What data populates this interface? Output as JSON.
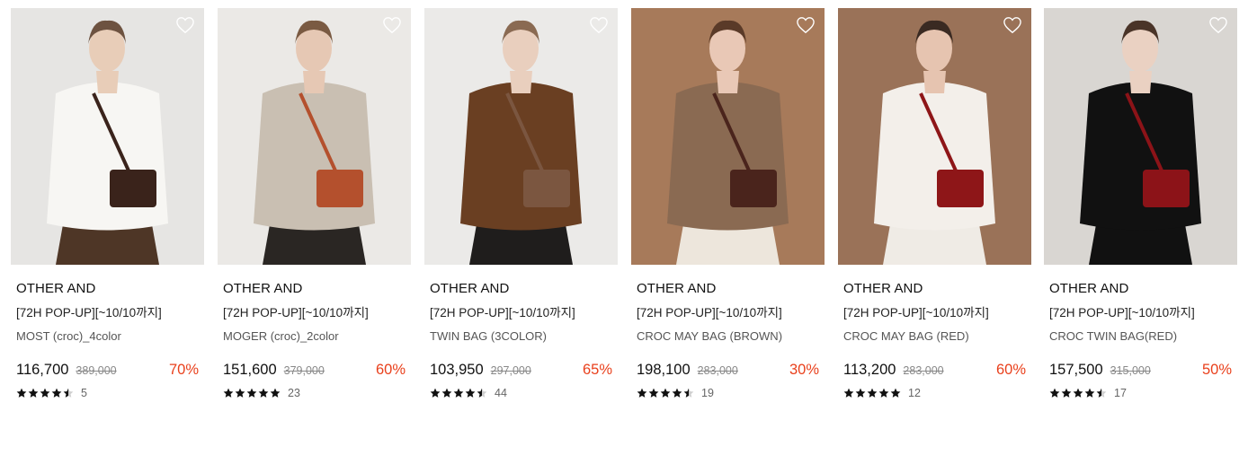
{
  "products": [
    {
      "brand": "OTHER AND",
      "promo": "[72H POP-UP][~10/10까지]",
      "name": "MOST (croc)_4color",
      "price": "116,700",
      "original_price": "389,000",
      "discount": "70%",
      "rating": 4.5,
      "review_count": "5",
      "colors": {
        "bg": "#e6e5e3",
        "coat": "#f7f6f3",
        "skirt": "#4e3626",
        "bag": "#3a231b",
        "skin": "#e8cdb8",
        "hair": "#6d5240"
      }
    },
    {
      "brand": "OTHER AND",
      "promo": "[72H POP-UP][~10/10까지]",
      "name": "MOGER (croc)_2color",
      "price": "151,600",
      "original_price": "379,000",
      "discount": "60%",
      "rating": 5,
      "review_count": "23",
      "colors": {
        "bg": "#ebe9e6",
        "coat": "#c9bfb2",
        "skirt": "#2a2623",
        "bag": "#b4502d",
        "skin": "#e6c8b4",
        "hair": "#7a5a42"
      }
    },
    {
      "brand": "OTHER AND",
      "promo": "[72H POP-UP][~10/10까지]",
      "name": "TWIN BAG (3COLOR)",
      "price": "103,950",
      "original_price": "297,000",
      "discount": "65%",
      "rating": 4.5,
      "review_count": "44",
      "colors": {
        "bg": "#ebeae8",
        "coat": "#6a3f22",
        "skirt": "#1f1d1c",
        "bag": "#7b5640",
        "skin": "#e9cfbe",
        "hair": "#8a6a52"
      }
    },
    {
      "brand": "OTHER AND",
      "promo": "[72H POP-UP][~10/10까지]",
      "name": "CROC MAY BAG (BROWN)",
      "price": "198,100",
      "original_price": "283,000",
      "discount": "30%",
      "rating": 4.5,
      "review_count": "19",
      "colors": {
        "bg": "#a77a5a",
        "coat": "#8a6a52",
        "skirt": "#ede6dc",
        "bag": "#4a241c",
        "skin": "#e9c8b6",
        "hair": "#5a3a28"
      }
    },
    {
      "brand": "OTHER AND",
      "promo": "[72H POP-UP][~10/10까지]",
      "name": "CROC MAY BAG (RED)",
      "price": "113,200",
      "original_price": "283,000",
      "discount": "60%",
      "rating": 5,
      "review_count": "12",
      "colors": {
        "bg": "#9a7258",
        "coat": "#f3efea",
        "skirt": "#efebe5",
        "bag": "#8e1618",
        "skin": "#e6c4b0",
        "hair": "#3a2a22"
      }
    },
    {
      "brand": "OTHER AND",
      "promo": "[72H POP-UP][~10/10까지]",
      "name": "CROC TWIN BAG(RED)",
      "price": "157,500",
      "original_price": "315,000",
      "discount": "50%",
      "rating": 4.5,
      "review_count": "17",
      "colors": {
        "bg": "#d9d6d2",
        "coat": "#111111",
        "skirt": "#111111",
        "bag": "#8c1318",
        "skin": "#ead1c2",
        "hair": "#4a3428"
      }
    }
  ],
  "accent_color": "#e9401c"
}
